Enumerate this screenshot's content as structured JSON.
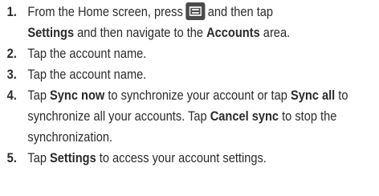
{
  "steps": [
    {
      "number": "1.",
      "t1": "From the Home screen, press",
      "t2": "and then tap",
      "b1": "Settings",
      "t3": "and then navigate to the",
      "b2": "Accounts",
      "t4": "area.",
      "icon": "menu-key-icon"
    },
    {
      "number": "2.",
      "t1": "Tap the account name."
    },
    {
      "number": "3.",
      "t1": "Tap the account name."
    },
    {
      "number": "4.",
      "t1": "Tap",
      "b1": "Sync now",
      "t2": "to synchronize your account or tap",
      "b2": "Sync all",
      "t3": "to synchronize all your accounts. Tap",
      "b3": "Cancel sync",
      "t4": "to stop the synchronization."
    },
    {
      "number": "5.",
      "t1": "Tap",
      "b1": "Settings",
      "t2": "to access your account settings."
    }
  ]
}
